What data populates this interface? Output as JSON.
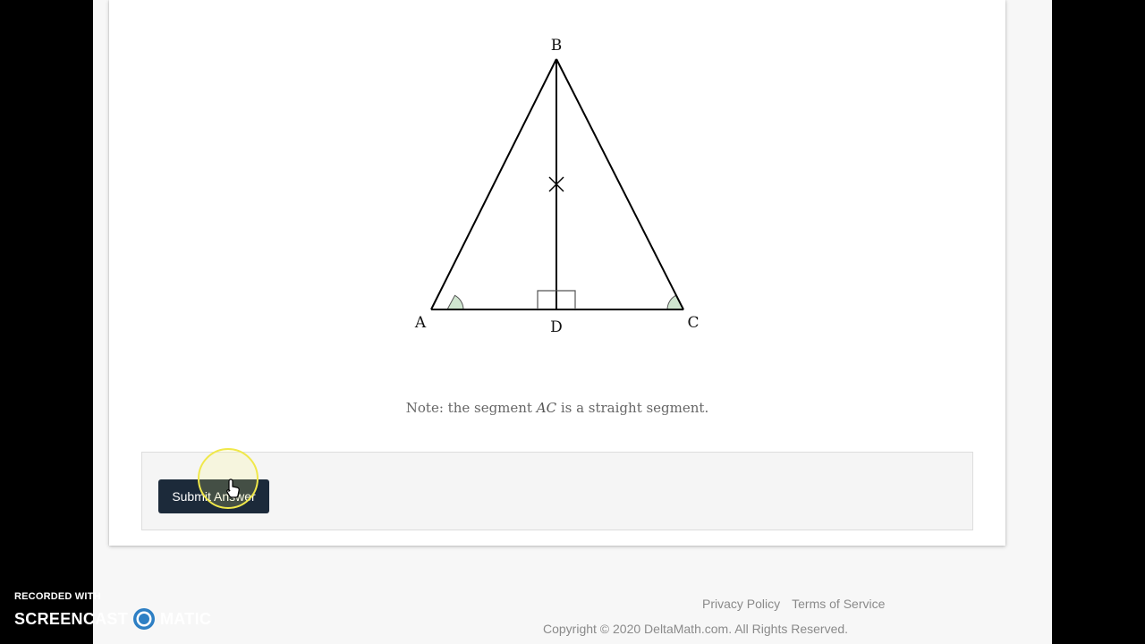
{
  "figure": {
    "labels": {
      "a": "A",
      "b": "B",
      "c": "C",
      "d": "D"
    }
  },
  "note": {
    "prefix": "Note: the segment ",
    "segment": "AC",
    "suffix": " is a straight segment."
  },
  "actions": {
    "submit_label": "Submit Answer"
  },
  "footer": {
    "privacy": "Privacy Policy",
    "terms": "Terms of Service",
    "copyright": "Copyright © 2020 DeltaMath.com. All Rights Reserved."
  },
  "watermark": {
    "recorded": "RECORDED WITH",
    "brand_left": "SCREENCAST",
    "brand_right": "MATIC"
  },
  "colors": {
    "button": "#1c2a3a",
    "angle_fill": "#cfe5cf",
    "highlight": "#f0e84a"
  }
}
